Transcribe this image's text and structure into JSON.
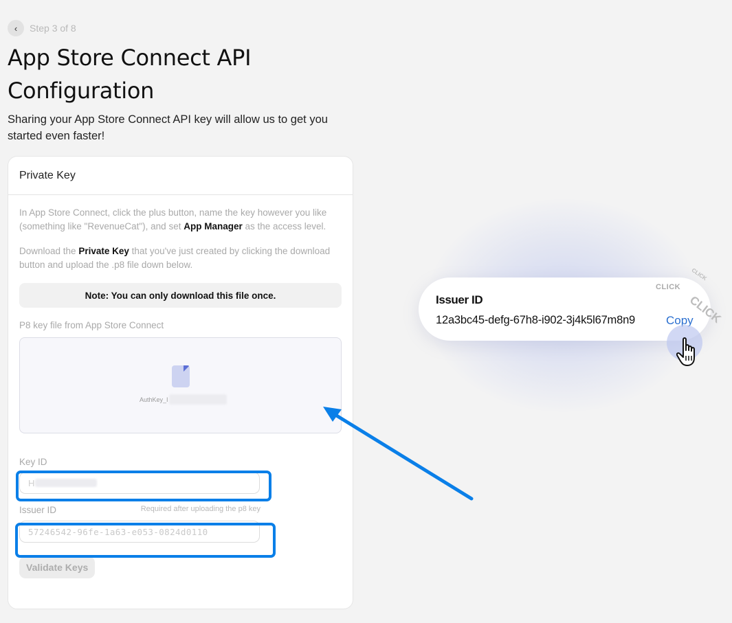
{
  "header": {
    "back_icon": "chevron-left-icon",
    "step_label": "Step 3 of 8",
    "title": "App Store Connect API Configuration",
    "subtitle": "Sharing your App Store Connect API key will allow us to get you started even faster!"
  },
  "card": {
    "title": "Private Key",
    "para1_a": "In App Store Connect, click the plus button, name the key however you like (something like \"RevenueCat\"), and set ",
    "para1_bold": "App Manager",
    "para1_b": " as the access level.",
    "para2_a": "Download the ",
    "para2_bold": "Private Key",
    "para2_b": " that you've just created by clicking the download button and upload the .p8 file down below.",
    "note": "Note: You can only download this file once.",
    "p8_label": "P8 key file from App Store Connect",
    "file_name": "AuthKey_I",
    "key_id_label": "Key ID",
    "key_id_value": "H",
    "issuer_label": "Issuer ID",
    "issuer_note": "Required after uploading the p8 key",
    "issuer_placeholder": "57246542-96fe-1a63-e053-0824d0110",
    "validate_label": "Validate Keys"
  },
  "callout": {
    "title": "Issuer ID",
    "value": "12a3bc45-defg-67h8-i902-3j4k5l67m8n9",
    "copy_label": "Copy",
    "click_text": "CLICK",
    "click_text_small": "CLICK",
    "click_text_large": "CLICK"
  },
  "colors": {
    "highlight": "#0a7fe8",
    "copy_link": "#2a6fd0",
    "background": "#f3f3f3"
  }
}
